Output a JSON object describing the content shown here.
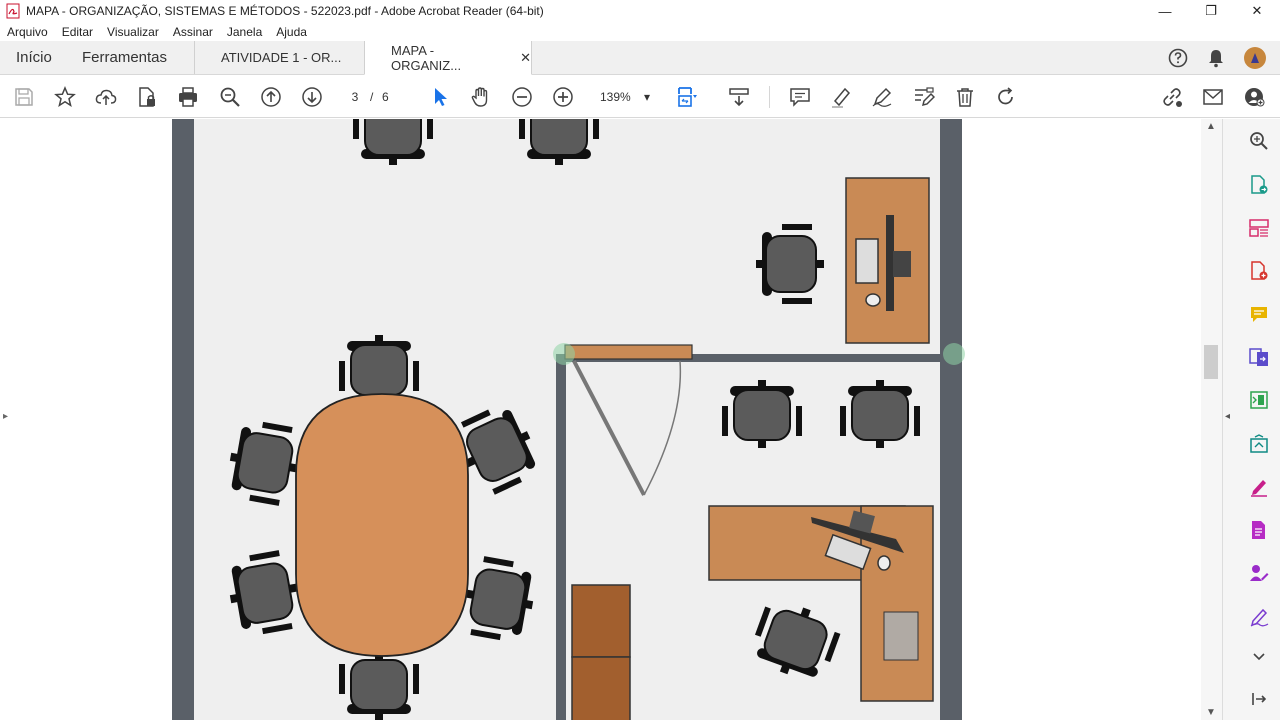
{
  "window": {
    "title": "MAPA - ORGANIZAÇÃO, SISTEMAS E MÉTODOS - 522023.pdf - Adobe Acrobat Reader (64-bit)",
    "minimize": "—",
    "maximize": "❐",
    "close": "✕"
  },
  "menu": [
    "Arquivo",
    "Editar",
    "Visualizar",
    "Assinar",
    "Janela",
    "Ajuda"
  ],
  "tabs": {
    "home": "Início",
    "tools": "Ferramentas",
    "doc1": "ATIVIDADE 1 - OR...",
    "doc2": "MAPA - ORGANIZ...",
    "close": "✕"
  },
  "toolbar": {
    "current_page": "3",
    "page_sep": "/",
    "total_pages": "6",
    "zoom": "139%",
    "zoom_caret": "▾"
  },
  "icons": {
    "help": "help-icon",
    "notifications": "bell-icon",
    "profile": "avatar"
  },
  "scroll": {
    "up": "▲",
    "down": "▼",
    "left_toggle": "▸",
    "right_toggle": "◂"
  },
  "colors": {
    "wall": "#5a6068",
    "floor": "#efefef",
    "table_fill": "#d6905a",
    "desk_fill": "#c98a55",
    "cabinet_fill": "#a25f2e",
    "chair_fill": "#5b5b5b",
    "accent_blue": "#1a73e8"
  }
}
